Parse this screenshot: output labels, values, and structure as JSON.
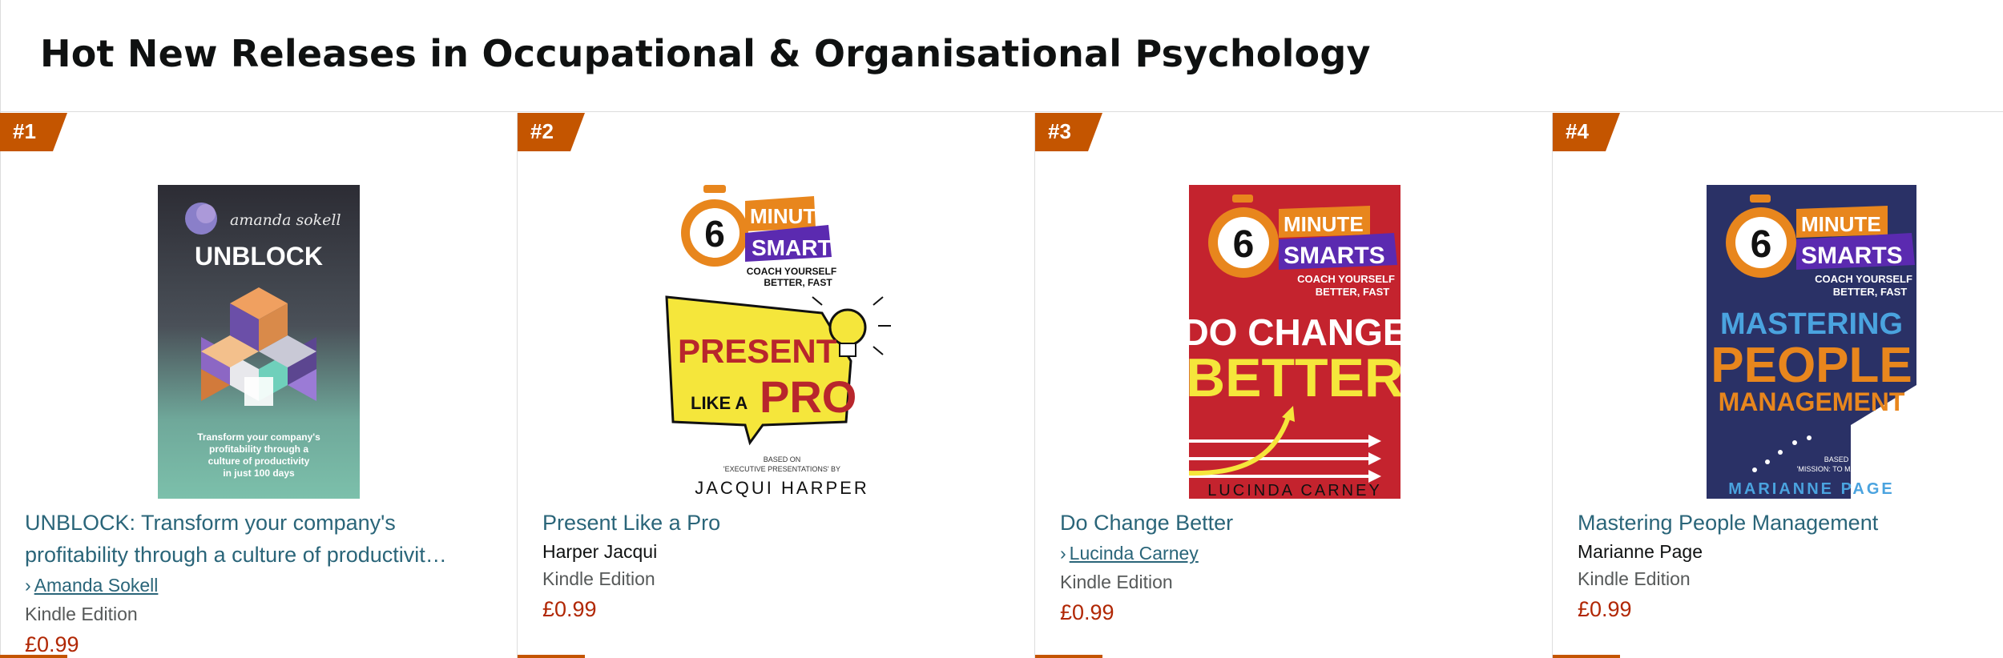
{
  "page": {
    "title": "Hot New Releases in Occupational & Organisational Psychology"
  },
  "colors": {
    "rank_badge": "#c45500",
    "link": "#2a6579",
    "price": "#b12704",
    "muted": "#565959"
  },
  "books": [
    {
      "rank": "#1",
      "title": "UNBLOCK: Transform your company's profitability through a culture of productivit…",
      "author": "Amanda Sokell",
      "author_is_link": true,
      "format": "Kindle Edition",
      "price": "£0.99",
      "cover": {
        "author_script": "amanda sokell",
        "heading": "UNBLOCK",
        "tagline_lines": [
          "Transform your company's",
          "profitability through a",
          "culture of productivity",
          "in just 100 days"
        ]
      }
    },
    {
      "rank": "#2",
      "title": "Present Like a Pro",
      "author": "Harper Jacqui",
      "author_is_link": false,
      "format": "Kindle Edition",
      "price": "£0.99",
      "cover": {
        "series_number": "6",
        "series_line1": "MINUTE",
        "series_line2": "SMARTS",
        "series_sub": [
          "COACH YOURSELF",
          "BETTER, FAST"
        ],
        "heading_1": "PRESENT",
        "heading_2a": "LIKE A",
        "heading_2b": "PRO",
        "based_on": [
          "BASED ON",
          "'EXECUTIVE PRESENTATIONS' BY"
        ],
        "author_caps": "JACQUI HARPER"
      }
    },
    {
      "rank": "#3",
      "title": "Do Change Better",
      "author": "Lucinda Carney",
      "author_is_link": true,
      "format": "Kindle Edition",
      "price": "£0.99",
      "cover": {
        "series_number": "6",
        "series_line1": "MINUTE",
        "series_line2": "SMARTS",
        "series_sub": [
          "COACH YOURSELF",
          "BETTER, FAST"
        ],
        "heading_1": "DO CHANGE",
        "heading_2": "BETTER",
        "author_caps": "LUCINDA CARNEY"
      }
    },
    {
      "rank": "#4",
      "title": "Mastering People Management",
      "author": "Marianne Page",
      "author_is_link": false,
      "format": "Kindle Edition",
      "price": "£0.99",
      "cover": {
        "series_number": "6",
        "series_line1": "MINUTE",
        "series_line2": "SMARTS",
        "series_sub": [
          "COACH YOURSELF",
          "BETTER, FAST"
        ],
        "heading_1": "MASTERING",
        "heading_2": "PEOPLE",
        "heading_3": "MANAGEMENT",
        "based_on": [
          "BASED ON",
          "'MISSION: TO MANAGE' BY"
        ],
        "author_caps": "MARIANNE PAGE"
      }
    }
  ]
}
